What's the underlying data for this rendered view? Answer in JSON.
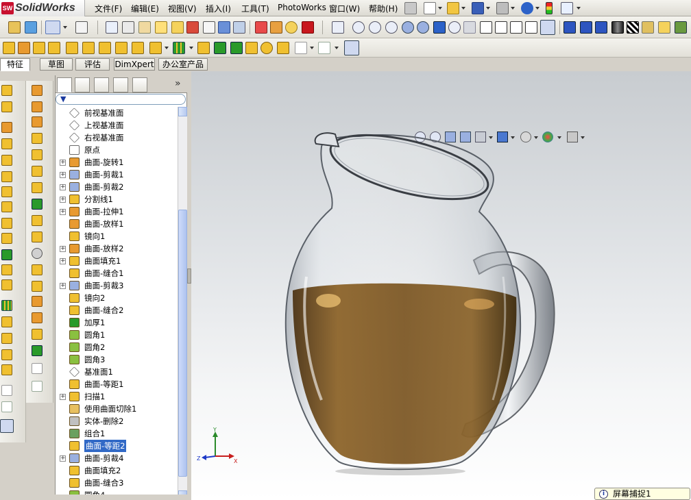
{
  "app": {
    "brand": "SolidWorks",
    "brand_badge": "SW"
  },
  "menu": [
    "文件(F)",
    "编辑(E)",
    "视图(V)",
    "插入(I)",
    "工具(T)",
    "PhotoWorks",
    "窗口(W)",
    "帮助(H)"
  ],
  "command_tabs": [
    {
      "label": "特征",
      "active": true
    },
    {
      "label": "草图",
      "active": false
    },
    {
      "label": "评估",
      "active": false
    },
    {
      "label": "DimXpert",
      "active": false
    },
    {
      "label": "办公室产品",
      "active": false
    }
  ],
  "feature_tree": {
    "items": [
      {
        "label": "前视基准面",
        "icon": "plane-icon",
        "expandable": false
      },
      {
        "label": "上视基准面",
        "icon": "plane-icon",
        "expandable": false
      },
      {
        "label": "右视基准面",
        "icon": "plane-icon",
        "expandable": false
      },
      {
        "label": "原点",
        "icon": "origin-icon",
        "expandable": false
      },
      {
        "label": "曲面-旋转1",
        "icon": "surface-revolve-icon",
        "expandable": true
      },
      {
        "label": "曲面-剪裁1",
        "icon": "surface-trim-icon",
        "expandable": true
      },
      {
        "label": "曲面-剪裁2",
        "icon": "surface-trim-icon",
        "expandable": true
      },
      {
        "label": "分割线1",
        "icon": "split-line-icon",
        "expandable": true
      },
      {
        "label": "曲面-拉伸1",
        "icon": "surface-extrude-icon",
        "expandable": true
      },
      {
        "label": "曲面-放样1",
        "icon": "surface-loft-icon",
        "expandable": false
      },
      {
        "label": "镜向1",
        "icon": "mirror-icon",
        "expandable": false
      },
      {
        "label": "曲面-放样2",
        "icon": "surface-loft-icon",
        "expandable": true
      },
      {
        "label": "曲面填充1",
        "icon": "surface-fill-icon",
        "expandable": true
      },
      {
        "label": "曲面-缝合1",
        "icon": "surface-knit-icon",
        "expandable": false
      },
      {
        "label": "曲面-剪裁3",
        "icon": "surface-trim-icon",
        "expandable": true
      },
      {
        "label": "镜向2",
        "icon": "mirror-icon",
        "expandable": false
      },
      {
        "label": "曲面-缝合2",
        "icon": "surface-knit-icon",
        "expandable": false
      },
      {
        "label": "加厚1",
        "icon": "thicken-icon",
        "expandable": false
      },
      {
        "label": "圆角1",
        "icon": "fillet-icon",
        "expandable": false
      },
      {
        "label": "圆角2",
        "icon": "fillet-icon",
        "expandable": false
      },
      {
        "label": "圆角3",
        "icon": "fillet-icon",
        "expandable": false
      },
      {
        "label": "基准面1",
        "icon": "plane-icon",
        "expandable": false
      },
      {
        "label": "曲面-等距1",
        "icon": "surface-offset-icon",
        "expandable": false
      },
      {
        "label": "扫描1",
        "icon": "sweep-icon",
        "expandable": true
      },
      {
        "label": "使用曲面切除1",
        "icon": "surface-cut-icon",
        "expandable": false
      },
      {
        "label": "实体-删除2",
        "icon": "delete-body-icon",
        "expandable": false
      },
      {
        "label": "组合1",
        "icon": "combine-icon",
        "expandable": false
      },
      {
        "label": "曲面-等距2",
        "icon": "surface-offset-icon",
        "expandable": false,
        "selected": true
      },
      {
        "label": "曲面-剪裁4",
        "icon": "surface-trim-icon",
        "expandable": true
      },
      {
        "label": "曲面填充2",
        "icon": "surface-fill-icon",
        "expandable": false
      },
      {
        "label": "曲面-缝合3",
        "icon": "surface-knit-icon",
        "expandable": false
      },
      {
        "label": "圆角4",
        "icon": "fillet-icon",
        "expandable": false
      }
    ]
  },
  "triad": {
    "x": "X",
    "y": "Y",
    "z": "Z"
  },
  "toast": {
    "text": "屏幕捕捉1",
    "icon": "info-icon"
  },
  "colors": {
    "menubar": "#e8e6de",
    "selection": "#3169c6",
    "liquid": "#7a5420",
    "glass": "#cfd3d8"
  }
}
